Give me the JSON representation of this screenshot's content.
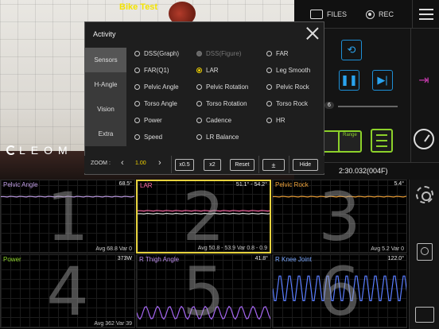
{
  "video": {
    "title": "Bike Test",
    "brand": "LEOM"
  },
  "topbar": {
    "files_label": "FILES",
    "rec_label": "REC"
  },
  "panel": {
    "slider_value": "6",
    "range_label": "Range",
    "timecode": "2:30.032(004F)"
  },
  "dialog": {
    "title": "Activity",
    "tabs": [
      "Sensors",
      "H-Angle",
      "Vision",
      "Extra"
    ],
    "active_tab": "Sensors",
    "options": [
      {
        "label": "DSS(Graph)",
        "state": "off"
      },
      {
        "label": "DSS(Figure)",
        "state": "disabled"
      },
      {
        "label": "FAR",
        "state": "off"
      },
      {
        "label": "FAR(Q1)",
        "state": "off"
      },
      {
        "label": "LAR",
        "state": "selected"
      },
      {
        "label": "Leg Smooth",
        "state": "off"
      },
      {
        "label": "Pelvic Angle",
        "state": "off"
      },
      {
        "label": "Pelvic Rotation",
        "state": "off"
      },
      {
        "label": "Pelvic Rock",
        "state": "off"
      },
      {
        "label": "Torso Angle",
        "state": "off"
      },
      {
        "label": "Torso Rotation",
        "state": "off"
      },
      {
        "label": "Torso Rock",
        "state": "off"
      },
      {
        "label": "Power",
        "state": "off"
      },
      {
        "label": "Cadence",
        "state": "off"
      },
      {
        "label": "HR",
        "state": "off"
      },
      {
        "label": "Speed",
        "state": "off"
      },
      {
        "label": "LR Balance",
        "state": "off"
      }
    ]
  },
  "zoom": {
    "label": "ZOOM :",
    "value": "1.00",
    "half_label": "x0.5",
    "double_label": "x2",
    "reset_label": "Reset",
    "plusminus_label": "±",
    "hide_label": "Hide"
  },
  "graphs": [
    {
      "num": "1",
      "title": "Pelvic Angle",
      "title_color": "#c09ee6",
      "value": "68.5°",
      "footer": "Avg 68.8  Var 0",
      "line_color": "#c09ee6",
      "waveform": "flat",
      "active": false
    },
    {
      "num": "2",
      "title": "LAR",
      "title_color": "#ff6aa8",
      "value": "51.1° - 54.2°",
      "footer": "Avg 50.8 - 53.9  Var 0.8 - 0.9",
      "line_color": "#ff6aa8",
      "waveform": "dual-flat",
      "active": true
    },
    {
      "num": "3",
      "title": "Pelvic Rock",
      "title_color": "#f0a33a",
      "value": "5.4°",
      "footer": "Avg 5.2  Var 0",
      "line_color": "#f0a33a",
      "waveform": "flat",
      "active": false
    },
    {
      "num": "4",
      "title": "Power",
      "title_color": "#8cd12a",
      "value": "373W",
      "footer": "Avg 362  Var 39",
      "line_color": "#8cd12a",
      "waveform": "none",
      "active": false
    },
    {
      "num": "5",
      "title": "R Thigh Angle",
      "title_color": "#b98be8",
      "value": "41.8°",
      "footer": "",
      "line_color": "#a466f0",
      "waveform": "sine-low",
      "active": false
    },
    {
      "num": "6",
      "title": "R Knee Joint",
      "title_color": "#7aa7ff",
      "value": "122.0°",
      "footer": "",
      "line_color": "#5a7dff",
      "waveform": "sine-high",
      "active": false
    }
  ]
}
